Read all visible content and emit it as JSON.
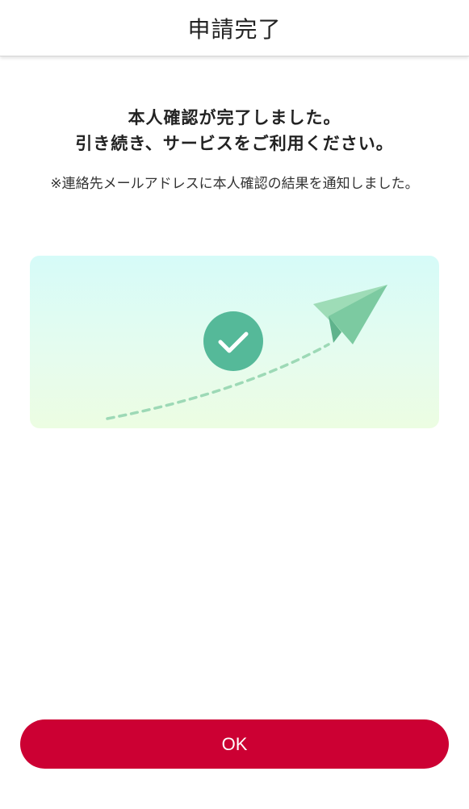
{
  "header": {
    "title": "申請完了"
  },
  "message": {
    "line1": "本人確認が完了しました。",
    "line2": "引き続き、サービスをご利用ください。"
  },
  "note": {
    "text": "※連絡先メールアドレスに本人確認の結果を通知しました。"
  },
  "illustration": {
    "check_icon": "check-circle-icon",
    "plane_icon": "paper-plane-icon",
    "check_color": "#55b999",
    "plane_color": "#8ed6b0"
  },
  "actions": {
    "ok_label": "OK",
    "ok_color": "#cc0033"
  }
}
